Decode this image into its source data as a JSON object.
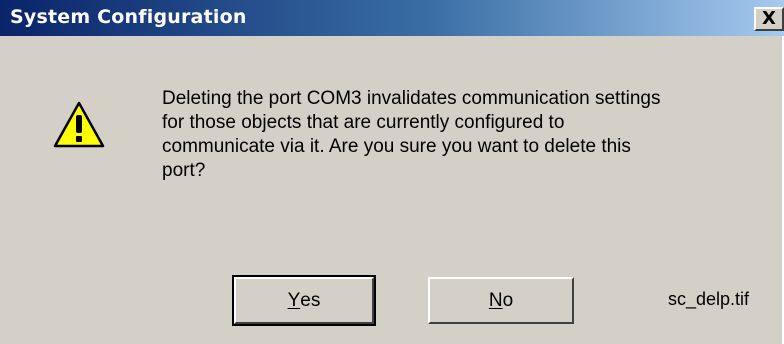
{
  "window": {
    "title": "System Configuration",
    "close_label": "X"
  },
  "message": {
    "lines": [
      "Deleting the port COM3 invalidates communication settings",
      "for those objects that are currently configured to",
      "communicate via it. Are you sure you want to delete this",
      "port?"
    ]
  },
  "buttons": {
    "yes": {
      "mnemonic": "Y",
      "rest": "es"
    },
    "no": {
      "mnemonic": "N",
      "rest": "o"
    }
  },
  "icon": "warning-icon",
  "file_label": "sc_delp.tif",
  "colors": {
    "title_bar": "#0a246a",
    "dialog_bg": "#d4d0c8",
    "icon_fill": "#ffff00"
  }
}
